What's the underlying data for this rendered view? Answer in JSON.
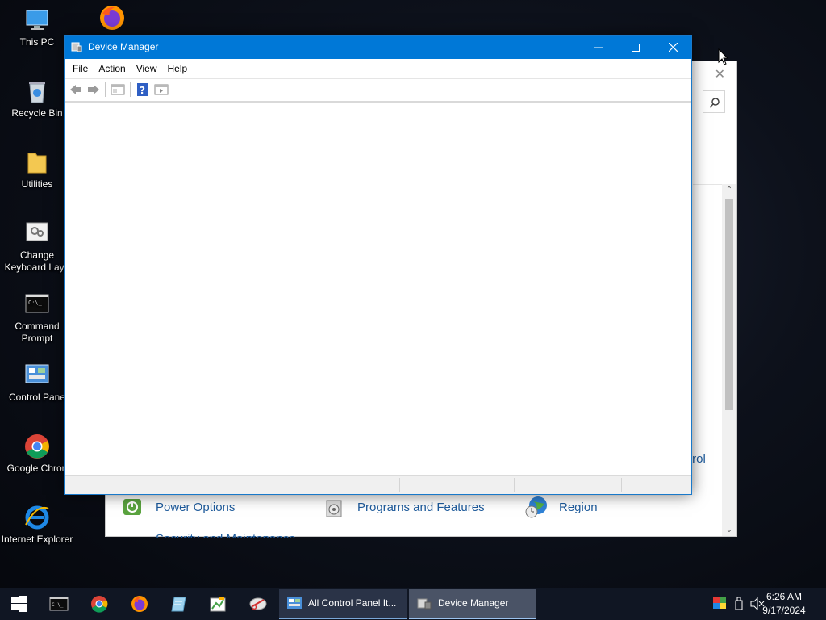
{
  "desktop": {
    "icons": [
      {
        "label": "This PC"
      },
      {
        "label": "Recycle Bin"
      },
      {
        "label": "Utilities"
      },
      {
        "label_line1": "Change",
        "label_line2": "Keyboard Layo"
      },
      {
        "label_line1": "Command",
        "label_line2": "Prompt"
      },
      {
        "label": "Control Pane"
      },
      {
        "label": "Google Chron"
      },
      {
        "label": "Internet Explorer"
      }
    ],
    "firefox_icon": "firefox-icon"
  },
  "control_panel": {
    "items": [
      {
        "label": "Power Options",
        "icon": "power-options-icon"
      },
      {
        "label": "Programs and Features",
        "icon": "programs-features-icon"
      },
      {
        "label": "Region",
        "icon": "region-icon"
      }
    ],
    "partial_text_right": "trol",
    "partial_text_bottom": "Security and Maintenance"
  },
  "device_manager": {
    "title": "Device Manager",
    "menu": [
      "File",
      "Action",
      "View",
      "Help"
    ],
    "toolbar": [
      "back-icon",
      "forward-icon",
      "show-hide-console-tree-icon",
      "help-icon",
      "properties-icon"
    ]
  },
  "taskbar": {
    "pinned": [
      "command-prompt-icon",
      "chrome-icon",
      "firefox-icon",
      "notepad-icon",
      "paint-icon",
      "snipping-icon"
    ],
    "tasks": [
      {
        "label": "All Control Panel It...",
        "active": false
      },
      {
        "label": "Device Manager",
        "active": true
      }
    ],
    "clock": {
      "time": "6:26 AM",
      "date": "9/17/2024"
    }
  }
}
